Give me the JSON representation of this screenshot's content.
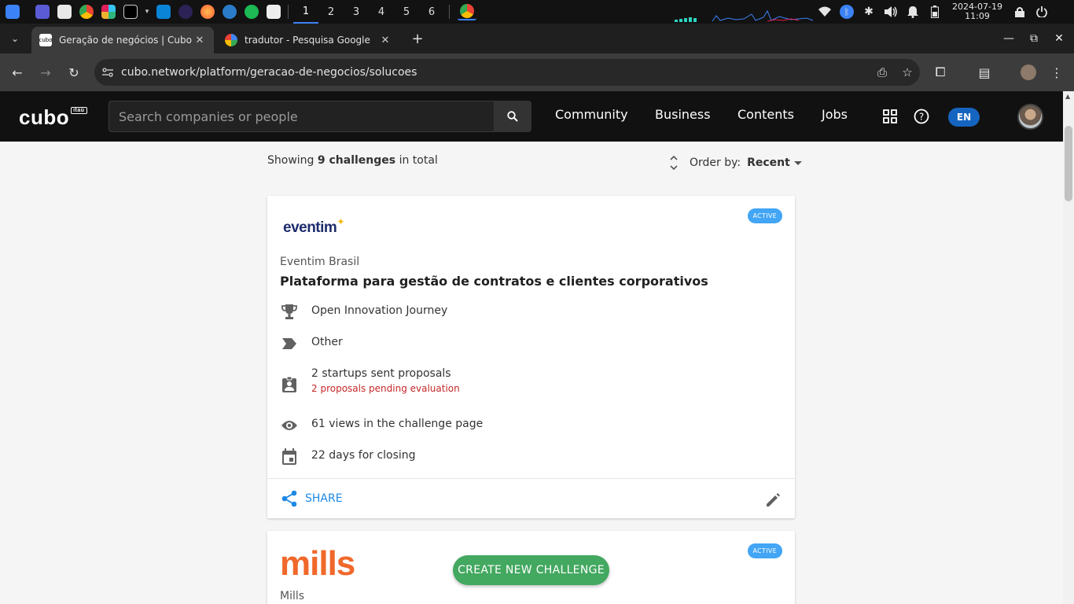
{
  "taskbar": {
    "workspaces": [
      "1",
      "2",
      "3",
      "4",
      "5",
      "6"
    ],
    "clock_date": "2024-07-19",
    "clock_time": "11:09"
  },
  "browser": {
    "tabs": [
      {
        "title": "Geração de negócios | Cubo",
        "favicon": "cubo-favicon"
      },
      {
        "title": "tradutor - Pesquisa Google",
        "favicon": "google-favicon"
      }
    ],
    "url": "cubo.network/platform/geracao-de-negocios/solucoes"
  },
  "header": {
    "logo": "cubo",
    "logo_badge": "itaú",
    "search_placeholder": "Search companies or people",
    "nav": [
      "Community",
      "Business",
      "Contents",
      "Jobs"
    ],
    "language": "EN"
  },
  "listing": {
    "showing_prefix": "Showing ",
    "showing_count": "9 challenges",
    "showing_suffix": " in total",
    "order_label": "Order by:",
    "order_value": "Recent"
  },
  "challenges": [
    {
      "logo_text": "eventim",
      "status": "ACTIVE",
      "company": "Eventim Brasil",
      "title": "Plataforma para gestão de contratos e clientes corporativos",
      "program": "Open Innovation Journey",
      "category": "Other",
      "proposals": "2 startups sent proposals",
      "pending": "2 proposals pending evaluation",
      "views": "61 views in the challenge page",
      "closing": "22 days for closing",
      "share_label": "SHARE"
    },
    {
      "logo_text": "mills",
      "status": "ACTIVE",
      "company": "Mills"
    }
  ],
  "create_button": "CREATE NEW CHALLENGE",
  "colors": {
    "active_badge": "#42a5f5",
    "pending_text": "#c62828",
    "share_blue": "#1e88e5",
    "create_green": "#43a860",
    "mills_orange": "#f0682a",
    "eventim_navy": "#1d2c6b"
  }
}
